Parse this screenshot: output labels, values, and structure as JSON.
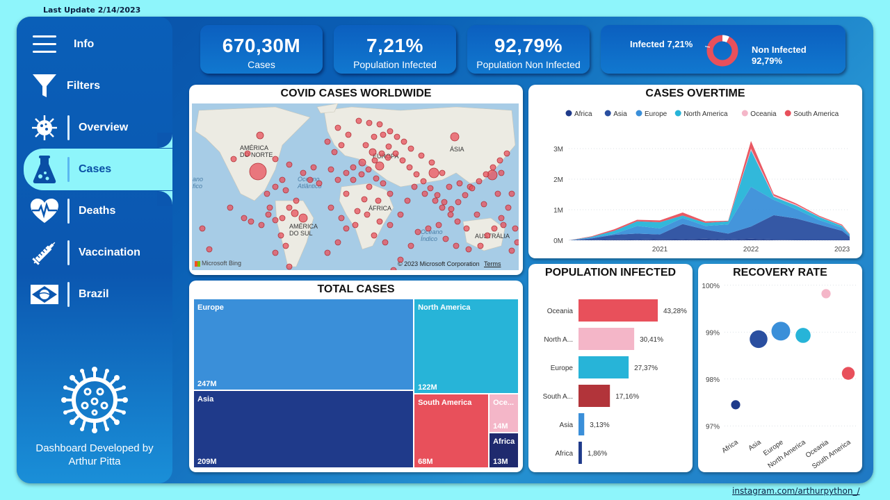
{
  "last_update": "Last Update 2/14/2023",
  "footer_link": "instagram.com/arthurpython_/",
  "sidebar": {
    "items": [
      {
        "label": "Info",
        "icon": "hamburger-menu-icon"
      },
      {
        "label": "Filters",
        "icon": "funnel-filter-icon"
      },
      {
        "label": "Overview",
        "icon": "virus-icon"
      },
      {
        "label": "Cases",
        "icon": "flask-icon",
        "active": true
      },
      {
        "label": "Deaths",
        "icon": "heart-pulse-icon"
      },
      {
        "label": "Vaccination",
        "icon": "syringe-icon"
      },
      {
        "label": "Brazil",
        "icon": "brazil-flag-icon"
      }
    ],
    "credit_line1": "Dashboard Developed by",
    "credit_line2": "Arthur Pitta"
  },
  "kpis": [
    {
      "value": "670,30M",
      "label": "Cases"
    },
    {
      "value": "7,21%",
      "label": "Population Infected"
    },
    {
      "value": "92,79%",
      "label": "Population Non Infected"
    }
  ],
  "donut": {
    "infected_label": "Infected 7,21%",
    "non_infected_label": "Non Infected",
    "non_infected_value": "92,79%",
    "infected_pct": 7.21,
    "colors": {
      "infected": "#3a8fd9",
      "non_infected": "#e8505b"
    }
  },
  "map": {
    "title": "COVID CASES WORLDWIDE",
    "labels": [
      "AMÉRICA DO NORTE",
      "EUROPA",
      "ÁSIA",
      "Oceano Atlântico",
      "ÁFRICA",
      "AMÉRICA DO SUL",
      "Oceano Índico",
      "AUSTRÁLIA",
      "ano fico"
    ],
    "attribution": "© 2023 Microsoft Corporation",
    "terms": "Terms",
    "brand": "Microsoft Bing",
    "bubble_color": "#e8505b"
  },
  "cases_overtime": {
    "title": "CASES OVERTIME",
    "chart_data": {
      "type": "area",
      "title": "CASES OVERTIME",
      "legend": [
        "Africa",
        "Asia",
        "Europe",
        "North America",
        "Oceania",
        "South America"
      ],
      "legend_colors": [
        "#1f3a8a",
        "#2a4fa0",
        "#3a8fd9",
        "#27b4d8",
        "#f4b6c8",
        "#e8505b"
      ],
      "y_ticks": [
        "0M",
        "1M",
        "2M",
        "3M"
      ],
      "x_ticks": [
        "2021",
        "2022",
        "2023"
      ],
      "ylim": [
        0,
        3.5
      ],
      "x": [
        "2020-01",
        "2020-04",
        "2020-07",
        "2020-10",
        "2021-01",
        "2021-04",
        "2021-07",
        "2021-10",
        "2022-01",
        "2022-04",
        "2022-07",
        "2022-10",
        "2023-01",
        "2023-02"
      ],
      "series": [
        {
          "name": "Africa",
          "values": [
            0,
            0.01,
            0.03,
            0.02,
            0.04,
            0.03,
            0.05,
            0.02,
            0.05,
            0.02,
            0.01,
            0.01,
            0.01,
            0.01
          ]
        },
        {
          "name": "Asia",
          "values": [
            0,
            0.05,
            0.15,
            0.2,
            0.15,
            0.5,
            0.3,
            0.2,
            0.4,
            0.8,
            0.7,
            0.5,
            0.3,
            0.1
          ]
        },
        {
          "name": "Europe",
          "values": [
            0,
            0.03,
            0.03,
            0.25,
            0.2,
            0.2,
            0.12,
            0.3,
            1.3,
            0.5,
            0.3,
            0.15,
            0.1,
            0.05
          ]
        },
        {
          "name": "North America",
          "values": [
            0,
            0.02,
            0.1,
            0.15,
            0.2,
            0.08,
            0.1,
            0.1,
            1.2,
            0.1,
            0.12,
            0.1,
            0.06,
            0.03
          ]
        },
        {
          "name": "Oceania",
          "values": [
            0,
            0,
            0,
            0,
            0,
            0,
            0,
            0,
            0.05,
            0.04,
            0.03,
            0.01,
            0.01,
            0
          ]
        },
        {
          "name": "South America",
          "values": [
            0,
            0.02,
            0.05,
            0.05,
            0.06,
            0.1,
            0.05,
            0.02,
            0.25,
            0.05,
            0.04,
            0.03,
            0.03,
            0.02
          ]
        }
      ]
    }
  },
  "total_cases": {
    "title": "TOTAL CASES",
    "chart_data": {
      "type": "treemap",
      "categories": [
        "Europe",
        "Asia",
        "North America",
        "South America",
        "Oceania",
        "Africa"
      ],
      "values": [
        247,
        209,
        122,
        68,
        14,
        13
      ],
      "labels": [
        "Europe",
        "Asia",
        "North America",
        "South America",
        "Oce...",
        "Africa"
      ],
      "value_labels": [
        "247M",
        "209M",
        "122M",
        "68M",
        "14M",
        "13M"
      ],
      "colors": [
        "#3a8fd9",
        "#1f3a8a",
        "#27b4d8",
        "#e8505b",
        "#f4b6c8",
        "#1f2a6e"
      ]
    }
  },
  "population_infected": {
    "title": "POPULATION INFECTED",
    "chart_data": {
      "type": "bar",
      "orientation": "horizontal",
      "categories": [
        "Oceania",
        "North A...",
        "Europe",
        "South A...",
        "Asia",
        "Africa"
      ],
      "values": [
        43.28,
        30.41,
        27.37,
        17.16,
        3.13,
        1.86
      ],
      "value_labels": [
        "43,28%",
        "30,41%",
        "27,37%",
        "17,16%",
        "3,13%",
        "1,86%"
      ],
      "colors": [
        "#e8505b",
        "#f4b6c8",
        "#27b4d8",
        "#b2343a",
        "#3a8fd9",
        "#1f3a8a"
      ]
    }
  },
  "recovery_rate": {
    "title": "RECOVERY RATE",
    "chart_data": {
      "type": "scatter",
      "categories": [
        "Africa",
        "Asia",
        "Europe",
        "North America",
        "Oceania",
        "South America"
      ],
      "values": [
        97.45,
        98.85,
        99.02,
        98.93,
        99.82,
        98.12
      ],
      "sizes": [
        13,
        209,
        247,
        122,
        14,
        68
      ],
      "y_ticks": [
        "97%",
        "98%",
        "99%",
        "100%"
      ],
      "ylim": [
        96.9,
        100.1
      ],
      "colors": [
        "#1f3a8a",
        "#2a4fa0",
        "#3a8fd9",
        "#27b4d8",
        "#f4b6c8",
        "#e8505b"
      ]
    }
  }
}
